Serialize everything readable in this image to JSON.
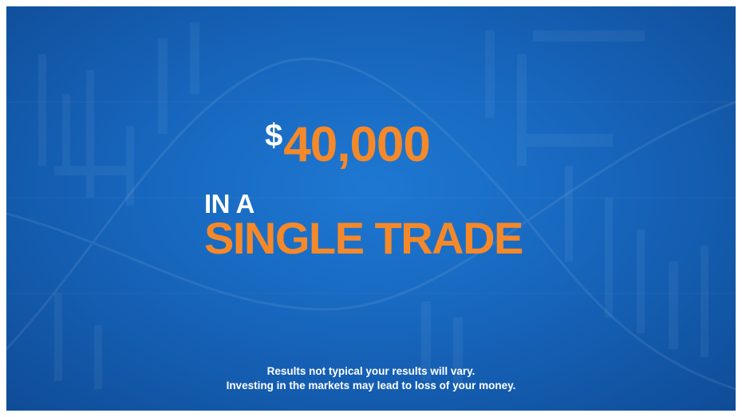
{
  "headline": {
    "amount_currency": "$",
    "amount_number": "40,000",
    "line_small": "IN A",
    "line_big": "SINGLE TRADE"
  },
  "disclaimer": {
    "line1": "Results not typical your results will vary.",
    "line2": "Investing in the markets may lead to loss of your money."
  },
  "colors": {
    "background": "#1766bd",
    "accent": "#f5892a",
    "text": "#ffffff"
  }
}
